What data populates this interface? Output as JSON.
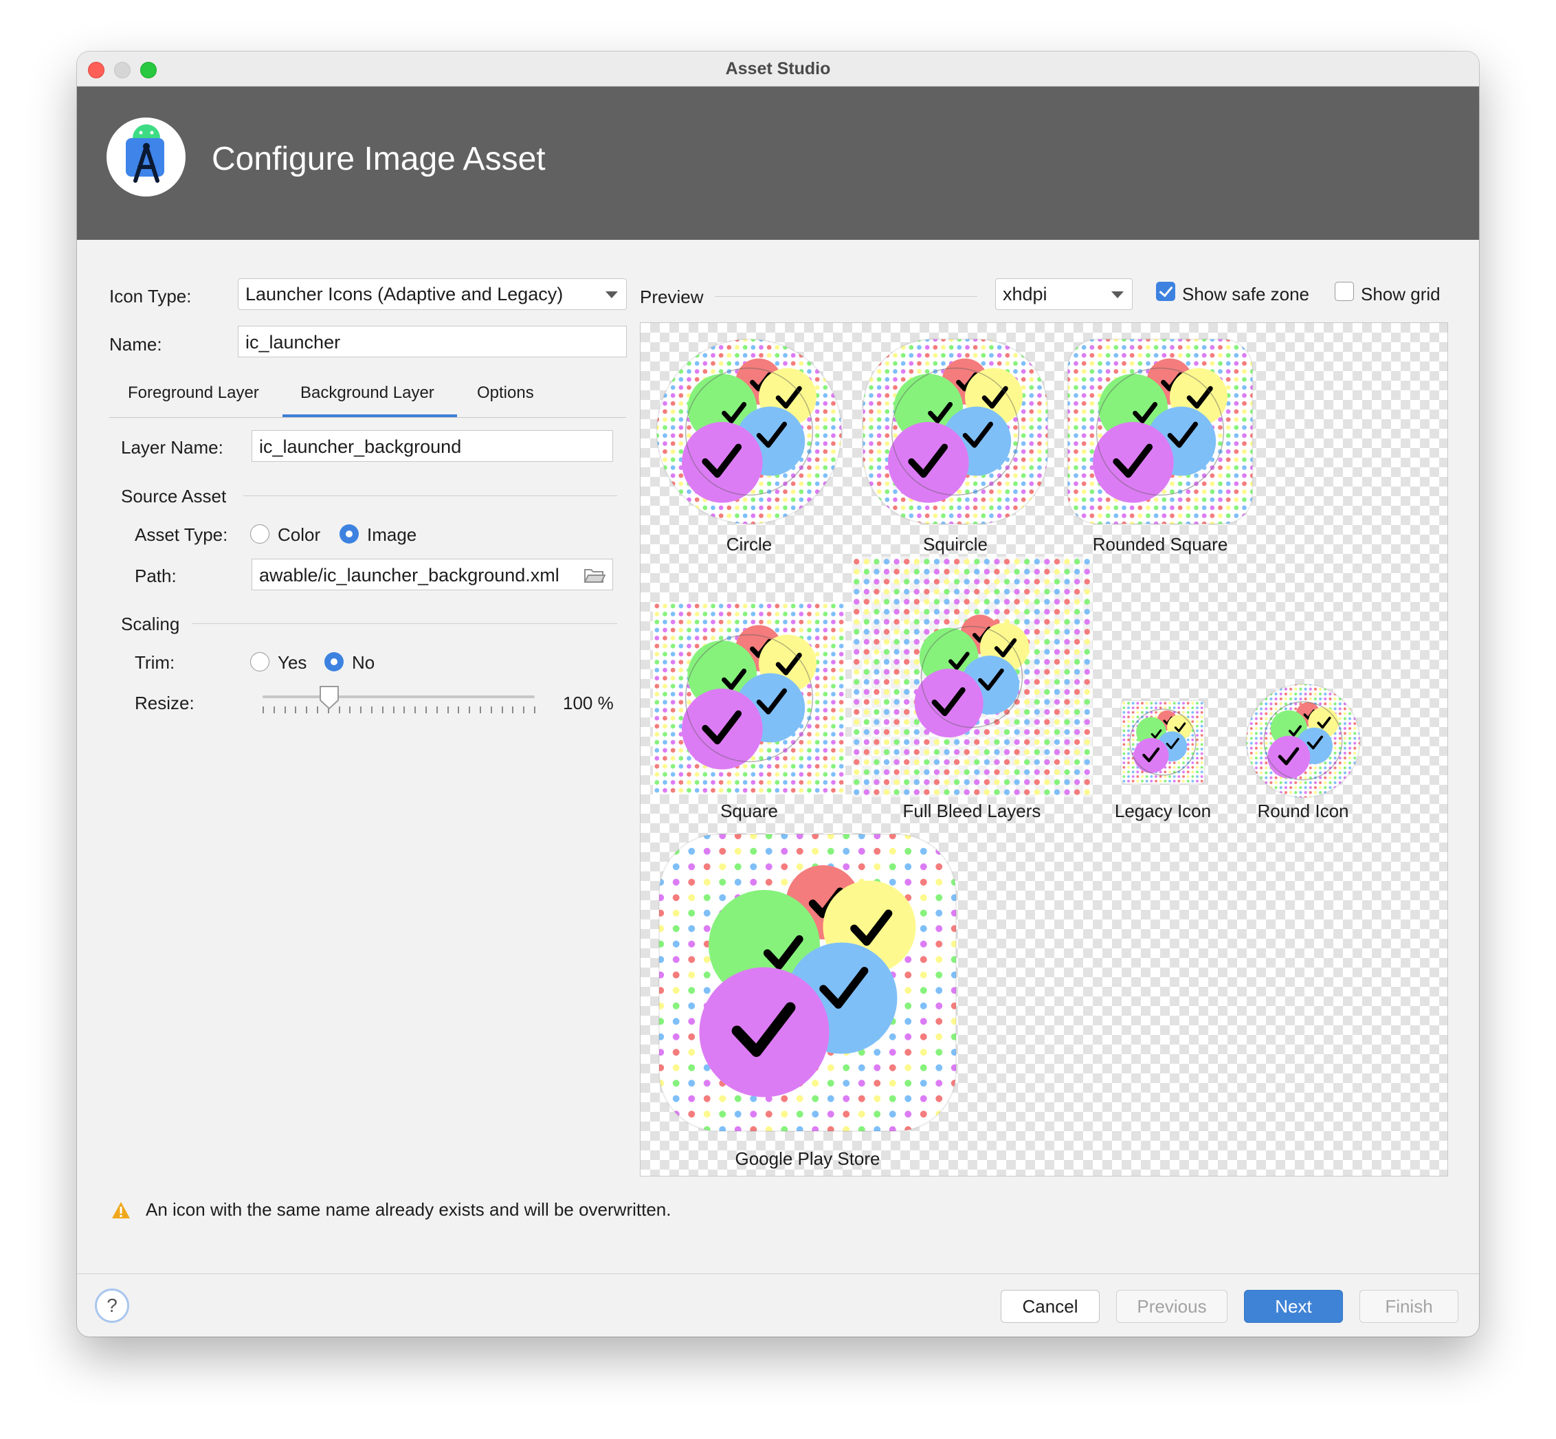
{
  "window": {
    "title": "Asset Studio"
  },
  "header": {
    "title": "Configure Image Asset",
    "logo_icon": "android-studio-icon"
  },
  "form": {
    "icon_type_label": "Icon Type:",
    "icon_type_value": "Launcher Icons (Adaptive and Legacy)",
    "name_label": "Name:",
    "name_value": "ic_launcher"
  },
  "tabs": [
    {
      "label": "Foreground Layer",
      "selected": false
    },
    {
      "label": "Background Layer",
      "selected": true
    },
    {
      "label": "Options",
      "selected": false
    }
  ],
  "layer": {
    "layer_name_label": "Layer Name:",
    "layer_name_value": "ic_launcher_background",
    "source_asset_heading": "Source Asset",
    "asset_type_label": "Asset Type:",
    "asset_type_options": [
      "Color",
      "Image"
    ],
    "asset_type_selected": "Image",
    "path_label": "Path:",
    "path_value": "awable/ic_launcher_background.xml",
    "scaling_heading": "Scaling",
    "trim_label": "Trim:",
    "trim_options": [
      "Yes",
      "No"
    ],
    "trim_selected": "No",
    "resize_label": "Resize:",
    "resize_value": "100 %"
  },
  "preview": {
    "label": "Preview",
    "density_value": "xhdpi",
    "show_safe_zone_label": "Show safe zone",
    "show_safe_zone_checked": true,
    "show_grid_label": "Show grid",
    "show_grid_checked": false,
    "captions": {
      "circle": "Circle",
      "squircle": "Squircle",
      "rounded_square": "Rounded Square",
      "square": "Square",
      "full_bleed": "Full Bleed Layers",
      "legacy": "Legacy Icon",
      "round": "Round Icon",
      "play_store": "Google Play Store"
    },
    "circle_colors": {
      "red": "#f47c7c",
      "yellow": "#fdf98e",
      "green": "#86f27c",
      "blue": "#7fbff8",
      "purple": "#dc7cf4"
    },
    "dot_colors": [
      "#f47c7c",
      "#fdf98e",
      "#86f27c",
      "#7fbff8",
      "#dc7cf4"
    ]
  },
  "warning": {
    "icon": "warning-icon",
    "text": "An icon with the same name already exists and will be overwritten."
  },
  "footer": {
    "help_icon": "help-icon",
    "help_label": "?",
    "cancel_label": "Cancel",
    "previous_label": "Previous",
    "next_label": "Next",
    "finish_label": "Finish"
  }
}
